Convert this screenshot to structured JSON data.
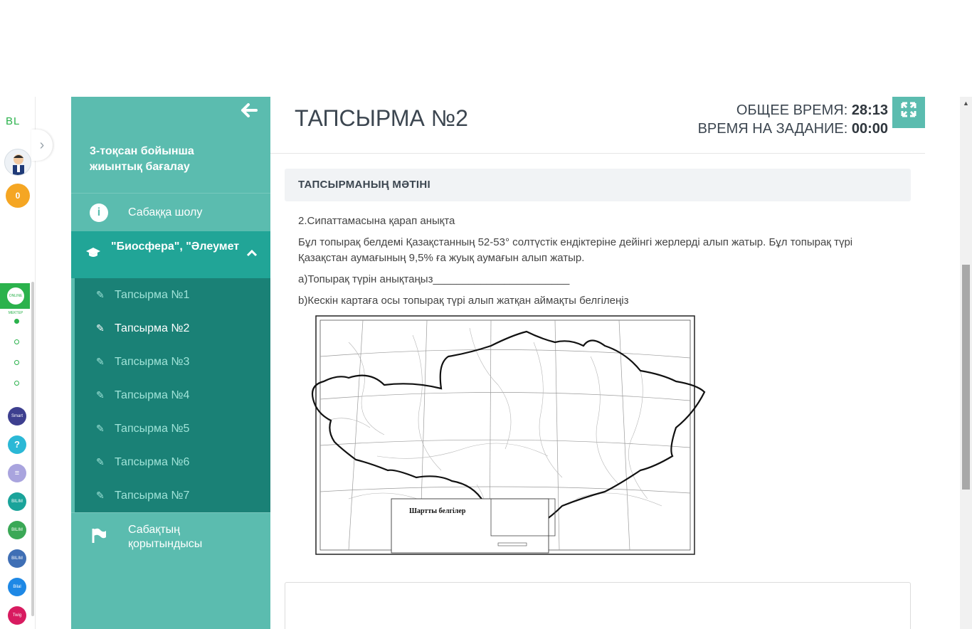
{
  "rail": {
    "logo": "BL",
    "coins": "0",
    "online": "ONLINE MEKTEP",
    "apps": [
      "Smart Nation",
      "?",
      "≡",
      "BILIM Online",
      "BILIM Land",
      "BILIM Book",
      "Bilal",
      "Twig"
    ]
  },
  "sidebar": {
    "course_title": "3-тоқсан бойынша жиынтық бағалау",
    "overview": "Сабаққа шолу",
    "section": "\"Биосфера\", \"Әлеуметтік геогр...",
    "tasks": [
      "Тапсырма №1",
      "Тапсырма №2",
      "Тапсырма №3",
      "Тапсырма №4",
      "Тапсырма №5",
      "Тапсырма №6",
      "Тапсырма №7"
    ],
    "active_task": "Тапсырма №2",
    "summary": "Сабақтың қорытындысы"
  },
  "header": {
    "title": "ТАПСЫРМА №2",
    "total_time_label": "ОБЩЕЕ ВРЕМЯ:",
    "total_time": "28:13",
    "task_time_label": "ВРЕМЯ НА ЗАДАНИЕ:",
    "task_time": "00:00"
  },
  "content": {
    "section_heading": "ТАПСЫРМАНЫҢ МӘТІНІ",
    "q_title": "2.Сипаттамасына қарап анықта",
    "q_body": "Бұл топырақ белдемі Қазақстанның 52-53° солтүстік ендіктеріне дейінгі жерлерді алып жатыр. Бұл топырақ түрі Қазақстан аумағының 9,5% ға жуық аумағын алып жатыр.",
    "q_a": "а)Топырақ түрін анықтаңыз_______________________",
    "q_b": "b)Кескін картаға осы топырақ түрі алып жатқан аймақты белгілеңіз",
    "map_legend": "Шартты белгілер"
  },
  "colors": {
    "teal": "#5bbcaf",
    "teal_dark": "#1a8176",
    "teal_section": "#21a597",
    "green": "#2bb24c",
    "coin": "#f5a623"
  }
}
